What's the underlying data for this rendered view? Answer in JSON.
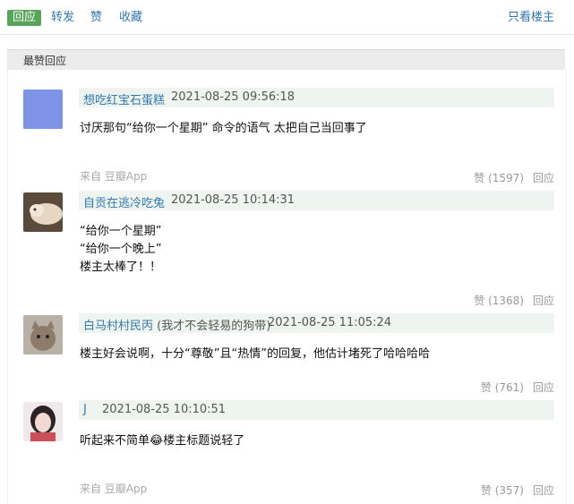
{
  "topbar": {
    "reply_label": "回应",
    "forward_label": "转发",
    "like_label": "赞",
    "collect_label": "收藏",
    "only_op_label": "只看楼主"
  },
  "section": {
    "title": "最赞回应"
  },
  "comments": [
    {
      "username": "想吃红宝石蛋糕",
      "signature": "",
      "time": "2021-08-25 09:56:18",
      "lines": [
        "讨厌那句“给你一个星期” 命令的语气 太把自己当回事了"
      ],
      "source": "来自 豆瓣App",
      "likes": "赞 (1597)",
      "reply": "回应",
      "avatar_color": "#7f93e6"
    },
    {
      "username": "自贡在逃冷吃兔",
      "signature": "",
      "time": "2021-08-25 10:14:31",
      "lines": [
        "“给你一个星期”",
        "“给你一个晚上”",
        "楼主太棒了！！"
      ],
      "source": "",
      "likes": "赞 (1368)",
      "reply": "回应",
      "avatar_color": "#c7b49a"
    },
    {
      "username": "白马村村民丙",
      "signature": "(我才不会轻易的狗带)",
      "time": "2021-08-25 11:05:24",
      "lines": [
        "楼主好会说啊，十分“尊敬”且“热情”的回复，他估计堵死了哈哈哈哈"
      ],
      "source": "",
      "likes": "赞 (761)",
      "reply": "回应",
      "avatar_color": "#9a8a7a"
    },
    {
      "username": "J",
      "signature": "",
      "time": "2021-08-25 10:10:51",
      "lines": [
        "听起来不简单😂楼主标题说轻了"
      ],
      "source": "来自 豆瓣App",
      "likes": "赞 (357)",
      "reply": "回应",
      "avatar_color": "#d9cfd3"
    }
  ]
}
